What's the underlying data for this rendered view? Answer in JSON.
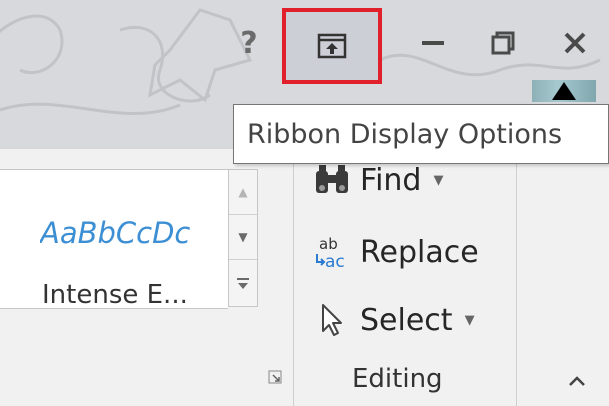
{
  "titlebar": {
    "help_label": "?",
    "ribbon_display_icon": "ribbon-display-options-icon",
    "minimize_icon": "minimize-icon",
    "restore_icon": "restore-icon",
    "close_icon": "close-icon",
    "highlight_color": "#e0202a"
  },
  "tooltip": {
    "text": "Ribbon Display Options"
  },
  "styles_gallery": {
    "sample_text": "AaBbCcDc",
    "style_name": "Intense E...",
    "sample_color": "#3d8fd4"
  },
  "editing": {
    "find_label": "Find",
    "replace_label": "Replace",
    "select_label": "Select",
    "group_label": "Editing"
  }
}
